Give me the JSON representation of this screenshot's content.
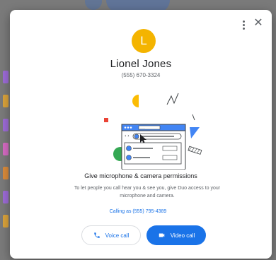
{
  "contact": {
    "initial": "L",
    "name": "Lionel Jones",
    "phone": "(555) 670-3324",
    "avatar_color": "#f4b400"
  },
  "illustration": {
    "browser_tab_text": "·······"
  },
  "permissions": {
    "title": "Give microphone & camera permissions",
    "body": "To let people you call hear you & see you, give Duo access to your microphone and camera."
  },
  "calling_as": "Calling as (555) 795-4389",
  "buttons": {
    "voice_call": "Voice call",
    "video_call": "Video call"
  },
  "icons": {
    "menu": "more-vert-icon",
    "close": "close-icon",
    "voice": "phone-icon",
    "video": "videocam-icon"
  },
  "colors": {
    "accent": "#1a73e8",
    "illustration_blue": "#4285f4",
    "illustration_green": "#34a853",
    "illustration_red": "#ea4335",
    "illustration_yellow": "#fbbc04"
  }
}
